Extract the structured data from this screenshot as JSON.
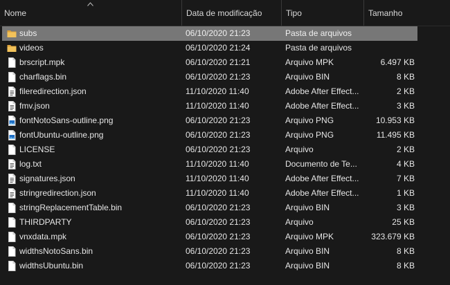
{
  "columns": {
    "name": "Nome",
    "date": "Data de modificação",
    "type": "Tipo",
    "size": "Tamanho"
  },
  "colors": {
    "folder": "#e8b64a",
    "selected_row": "#777777",
    "background": "#191919"
  },
  "files": [
    {
      "name": "subs",
      "date": "06/10/2020 21:23",
      "type": "Pasta de arquivos",
      "size": "",
      "icon": "folder-icon",
      "selected": true
    },
    {
      "name": "videos",
      "date": "06/10/2020 21:24",
      "type": "Pasta de arquivos",
      "size": "",
      "icon": "folder-icon"
    },
    {
      "name": "brscript.mpk",
      "date": "06/10/2020 21:21",
      "type": "Arquivo MPK",
      "size": "6.497 KB",
      "icon": "file-icon"
    },
    {
      "name": "charflags.bin",
      "date": "06/10/2020 21:23",
      "type": "Arquivo BIN",
      "size": "8 KB",
      "icon": "file-icon"
    },
    {
      "name": "fileredirection.json",
      "date": "11/10/2020 11:40",
      "type": "Adobe After Effect...",
      "size": "2 KB",
      "icon": "text-file-icon"
    },
    {
      "name": "fmv.json",
      "date": "11/10/2020 11:40",
      "type": "Adobe After Effect...",
      "size": "3 KB",
      "icon": "text-file-icon"
    },
    {
      "name": "fontNotoSans-outline.png",
      "date": "06/10/2020 21:23",
      "type": "Arquivo PNG",
      "size": "10.953 KB",
      "icon": "image-file-icon"
    },
    {
      "name": "fontUbuntu-outline.png",
      "date": "06/10/2020 21:23",
      "type": "Arquivo PNG",
      "size": "11.495 KB",
      "icon": "image-file-icon"
    },
    {
      "name": "LICENSE",
      "date": "06/10/2020 21:23",
      "type": "Arquivo",
      "size": "2 KB",
      "icon": "file-icon"
    },
    {
      "name": "log.txt",
      "date": "11/10/2020 11:40",
      "type": "Documento de Te...",
      "size": "4 KB",
      "icon": "text-file-icon"
    },
    {
      "name": "signatures.json",
      "date": "11/10/2020 11:40",
      "type": "Adobe After Effect...",
      "size": "7 KB",
      "icon": "text-file-icon"
    },
    {
      "name": "stringredirection.json",
      "date": "11/10/2020 11:40",
      "type": "Adobe After Effect...",
      "size": "1 KB",
      "icon": "text-file-icon"
    },
    {
      "name": "stringReplacementTable.bin",
      "date": "06/10/2020 21:23",
      "type": "Arquivo BIN",
      "size": "3 KB",
      "icon": "file-icon"
    },
    {
      "name": "THIRDPARTY",
      "date": "06/10/2020 21:23",
      "type": "Arquivo",
      "size": "25 KB",
      "icon": "file-icon"
    },
    {
      "name": "vnxdata.mpk",
      "date": "06/10/2020 21:23",
      "type": "Arquivo MPK",
      "size": "323.679 KB",
      "icon": "file-icon"
    },
    {
      "name": "widthsNotoSans.bin",
      "date": "06/10/2020 21:23",
      "type": "Arquivo BIN",
      "size": "8 KB",
      "icon": "file-icon"
    },
    {
      "name": "widthsUbuntu.bin",
      "date": "06/10/2020 21:23",
      "type": "Arquivo BIN",
      "size": "8 KB",
      "icon": "file-icon"
    }
  ]
}
